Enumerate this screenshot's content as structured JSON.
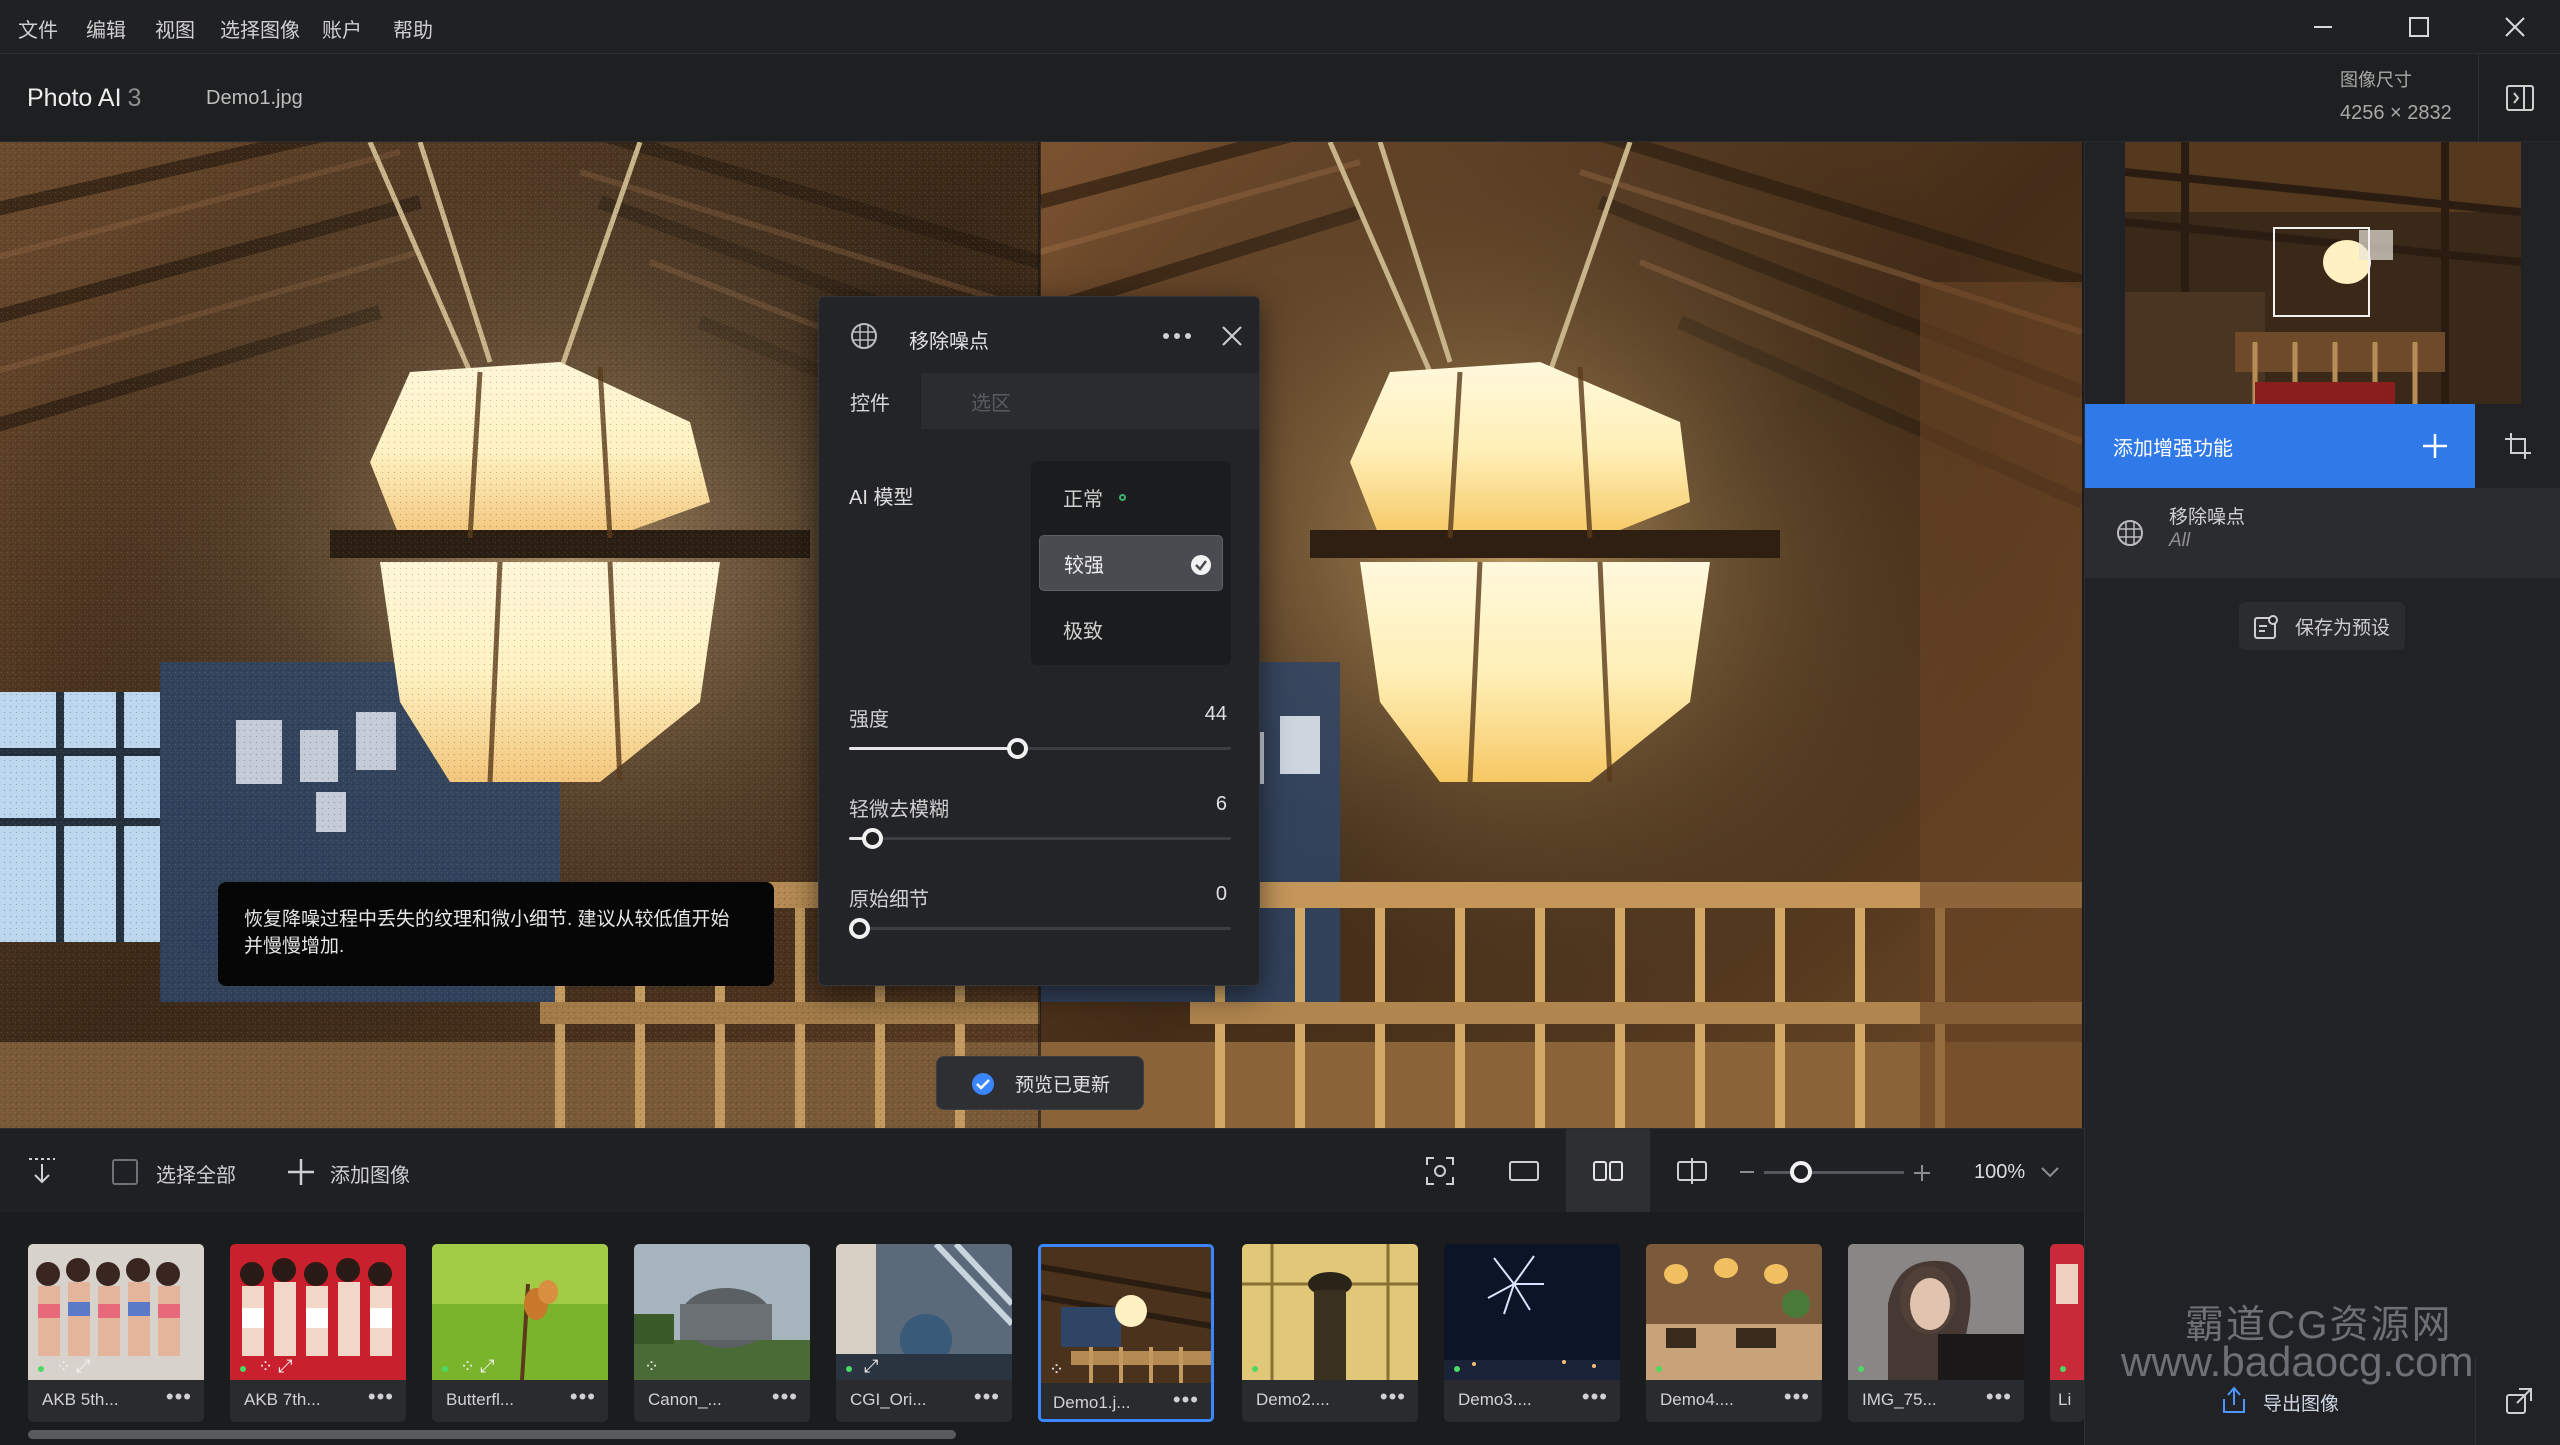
{
  "menubar": {
    "items": [
      "文件",
      "编辑",
      "视图",
      "选择图像",
      "账户",
      "帮助"
    ]
  },
  "header": {
    "app_name": "Photo AI",
    "app_version": "3",
    "file_name": "Demo1.jpg",
    "image_size_label": "图像尺寸",
    "image_size_value": "4256 × 2832"
  },
  "denoise_panel": {
    "title": "移除噪点",
    "tabs": [
      "控件",
      "选区"
    ],
    "model_label": "AI 模型",
    "models": [
      "正常",
      "较强",
      "极致"
    ],
    "selected_model": "较强",
    "sliders": [
      {
        "label": "强度",
        "value": 44
      },
      {
        "label": "轻微去模糊",
        "value": 6
      },
      {
        "label": "原始细节",
        "value": 0
      }
    ]
  },
  "tooltip": {
    "line1": "恢复降噪过程中丢失的纹理和微小细节. 建议从较低值开始",
    "line2": "并慢慢增加."
  },
  "toast": {
    "text": "预览已更新"
  },
  "right_panel": {
    "add_enhancement": "添加增强功能",
    "enhancement": {
      "name": "移除噪点",
      "sub": "All"
    },
    "save_preset": "保存为预设",
    "export": "导出图像",
    "watermark_line1": "霸道CG资源网",
    "watermark_line2": "www.badaocg.com"
  },
  "toolbar": {
    "select_all": "选择全部",
    "add_image": "添加图像",
    "zoom": "100%"
  },
  "filmstrip": {
    "thumbnails": [
      {
        "name": "AKB 5th..."
      },
      {
        "name": "AKB 7th..."
      },
      {
        "name": "Butterfl..."
      },
      {
        "name": "Canon_..."
      },
      {
        "name": "CGI_Ori..."
      },
      {
        "name": "Demo1.j..."
      },
      {
        "name": "Demo2...."
      },
      {
        "name": "Demo3...."
      },
      {
        "name": "Demo4...."
      },
      {
        "name": "IMG_75..."
      },
      {
        "name": "Li"
      }
    ],
    "active_index": 5
  },
  "colors": {
    "accent": "#2f79e8",
    "active_thumb_border": "#3a86ff",
    "status_dot": "#4cd964"
  }
}
